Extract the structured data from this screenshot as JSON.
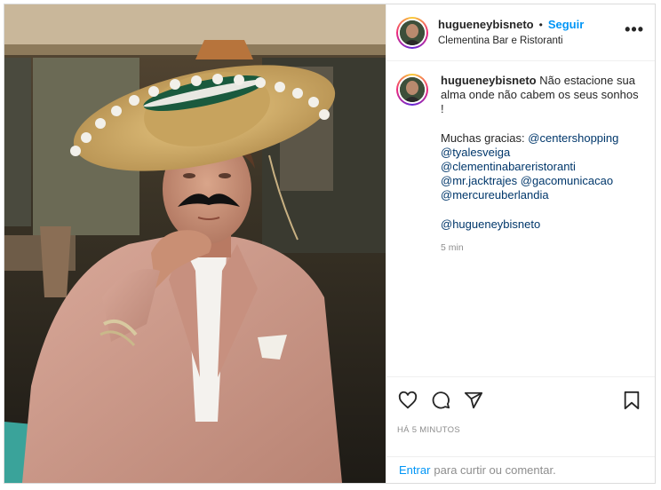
{
  "post": {
    "username": "hugueneybisneto",
    "separator": "•",
    "follow_label": "Seguir",
    "location": "Clementina Bar e Ristoranti",
    "more_label": "•••"
  },
  "caption": {
    "username": "hugueneybisneto",
    "text": "Não estacione sua alma onde não cabem os seus sonhos !",
    "thanks": "Muchas gracias:",
    "mentions": [
      "@centershopping",
      "@tyalesveiga",
      "@clementinabareristoranti",
      "@mr.jacktrajes",
      "@gacomunicacao",
      "@mercureuberlandia"
    ],
    "signature": "@hugueneybisneto",
    "time": "5 min"
  },
  "actions": {
    "like_icon": "heart-icon",
    "comment_icon": "comment-icon",
    "share_icon": "share-icon",
    "save_icon": "bookmark-icon",
    "posted_time": "HÁ 5 MINUTOS"
  },
  "login": {
    "link": "Entrar",
    "text": "para curtir ou comentar."
  },
  "colors": {
    "accent": "#0095f6",
    "mention": "#00376b",
    "muted": "#8e8e8e"
  }
}
